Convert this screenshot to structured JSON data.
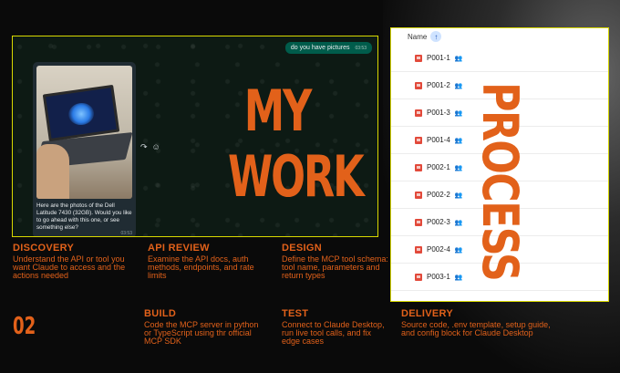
{
  "chat": {
    "sent_message": "do you have pictures",
    "sent_time": "03:53",
    "image_caption": "Here are the photos of the Dell Latitude 7430 (32GB). Would you like to go ahead with this one, or see something else?",
    "image_time": "03:53"
  },
  "headline": {
    "line1": "MY",
    "line2": "WORK"
  },
  "file_list": {
    "header": "Name",
    "rows": [
      "P001-1",
      "P001-2",
      "P001-3",
      "P001-4",
      "P002-1",
      "P002-2",
      "P002-3",
      "P002-4",
      "P003-1"
    ]
  },
  "side_title": "PROCESS",
  "step_number": "02",
  "steps": {
    "discovery": {
      "title": "DISCOVERY",
      "desc": "Understand the API or tool you want Claude to access and the actions needed"
    },
    "api_review": {
      "title": "API REVIEW",
      "desc": "Examine the API docs, auth methods, endpoints, and rate limits"
    },
    "design": {
      "title": "DESIGN",
      "desc": "Define the MCP tool schema: tool name, parameters and return types"
    },
    "build": {
      "title": "BUILD",
      "desc": "Code the MCP server in python or TypeScript using thr official MCP SDK"
    },
    "test": {
      "title": "TEST",
      "desc": "Connect to Claude Desktop, run live tool calls, and fix edge cases"
    },
    "delivery": {
      "title": "DELIVERY",
      "desc": "Source code, .env template, setup guide, and config block for Claude Desktop"
    }
  },
  "colors": {
    "accent": "#e2611a",
    "frame": "#d8d800"
  },
  "icons": [
    "sort-up-icon",
    "image-file-icon",
    "shared-people-icon",
    "forward-icon",
    "emoji-icon"
  ]
}
